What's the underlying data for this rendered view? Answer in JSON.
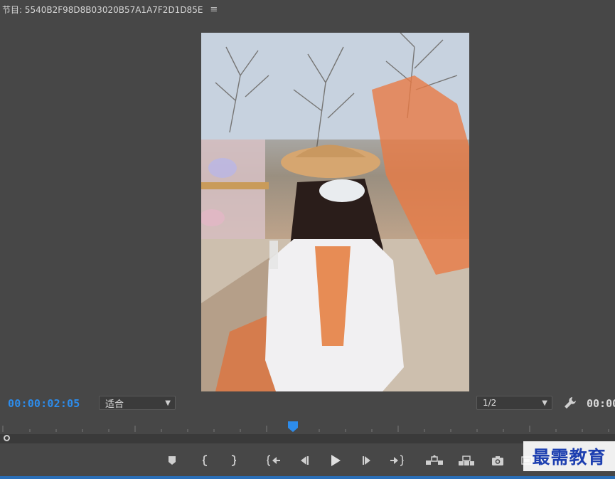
{
  "panel": {
    "title": "节目: 5540B2F98D8B03020B57A1A7F2D1D85E",
    "menu_glyph": "≡"
  },
  "viewer": {
    "description_icon": "video-frame"
  },
  "timecode": {
    "current": "00:00:02:05",
    "duration_partial": "00:00"
  },
  "fit_select": {
    "value": "适合"
  },
  "resolution_select": {
    "value": "1/2"
  },
  "controls": {
    "icons": [
      "add-marker-icon",
      "mark-in-icon",
      "mark-out-icon",
      "go-to-in-icon",
      "step-back-icon",
      "play-icon",
      "step-forward-icon",
      "go-to-out-icon",
      "lift-icon",
      "extract-icon",
      "export-frame-icon",
      "button-editor-icon"
    ]
  },
  "colors": {
    "accent": "#2d8ceb",
    "panel_bg": "#474747",
    "playhead": "#2d8ceb"
  },
  "watermark": {
    "text": "最需教育"
  }
}
